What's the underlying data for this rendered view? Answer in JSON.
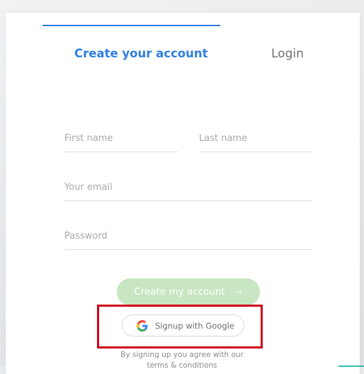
{
  "tabs": {
    "create_label": "Create your account",
    "login_label": "Login"
  },
  "form": {
    "first_name_placeholder": "First name",
    "last_name_placeholder": "Last name",
    "email_placeholder": "Your email",
    "password_placeholder": "Password",
    "submit_label": "Create my account",
    "submit_arrow": "→"
  },
  "google": {
    "label": "Signup with Google",
    "icon": "google-g-icon"
  },
  "terms": {
    "line1": "By signing up you agree with our",
    "link": "terms & conditions"
  },
  "colors": {
    "accent_blue": "#2f7fe0",
    "button_green": "#c7e6c1",
    "highlight_red": "#d0021b"
  }
}
